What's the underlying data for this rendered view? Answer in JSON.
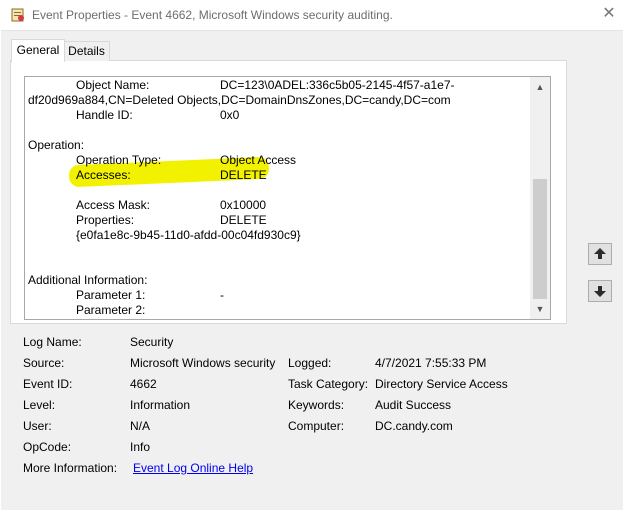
{
  "window": {
    "title": "Event Properties - Event 4662, Microsoft Windows security auditing.",
    "close_glyph": "✕"
  },
  "tabs": [
    {
      "label": "General",
      "selected": true
    },
    {
      "label": "Details",
      "selected": false
    }
  ],
  "description": {
    "object_name_label": "Object Name:",
    "object_name_value_1": "DC=123\\0ADEL:336c5b05-2145-4f57-a1e7-",
    "object_name_value_2": "df20d969a884,CN=Deleted Objects,DC=DomainDnsZones,DC=candy,DC=com",
    "handle_id_label": "Handle ID:",
    "handle_id_value": "0x0",
    "operation_label": "Operation:",
    "operation_type_label": "Operation Type:",
    "operation_type_value": "Object Access",
    "accesses_label": "Accesses:",
    "accesses_value": "DELETE",
    "access_mask_label": "Access Mask:",
    "access_mask_value": "0x10000",
    "properties_label": "Properties:",
    "properties_value": "DELETE",
    "properties_guid": "{e0fa1e8c-9b45-11d0-afdd-00c04fd930c9}",
    "additional_info_label": "Additional Information:",
    "parameter1_label": "Parameter 1:",
    "parameter1_value": "-",
    "parameter2_label": "Parameter 2:",
    "highlight_color": "#f2f200"
  },
  "scrollbar": {
    "up_glyph": "▲",
    "down_glyph": "▼"
  },
  "nav": {
    "up_icon": "up-arrow-icon",
    "down_icon": "down-arrow-icon"
  },
  "details": {
    "log_name_label": "Log Name:",
    "log_name_value": "Security",
    "source_label": "Source:",
    "source_value": "Microsoft Windows security",
    "logged_label": "Logged:",
    "logged_value": "4/7/2021 7:55:33 PM",
    "event_id_label": "Event ID:",
    "event_id_value": "4662",
    "task_category_label": "Task Category:",
    "task_category_value": "Directory Service Access",
    "level_label": "Level:",
    "level_value": "Information",
    "keywords_label": "Keywords:",
    "keywords_value": "Audit Success",
    "user_label": "User:",
    "user_value": "N/A",
    "computer_label": "Computer:",
    "computer_value": "DC.candy.com",
    "opcode_label": "OpCode:",
    "opcode_value": "Info",
    "more_info_label": "More Information:",
    "more_info_link": "Event Log Online Help"
  }
}
